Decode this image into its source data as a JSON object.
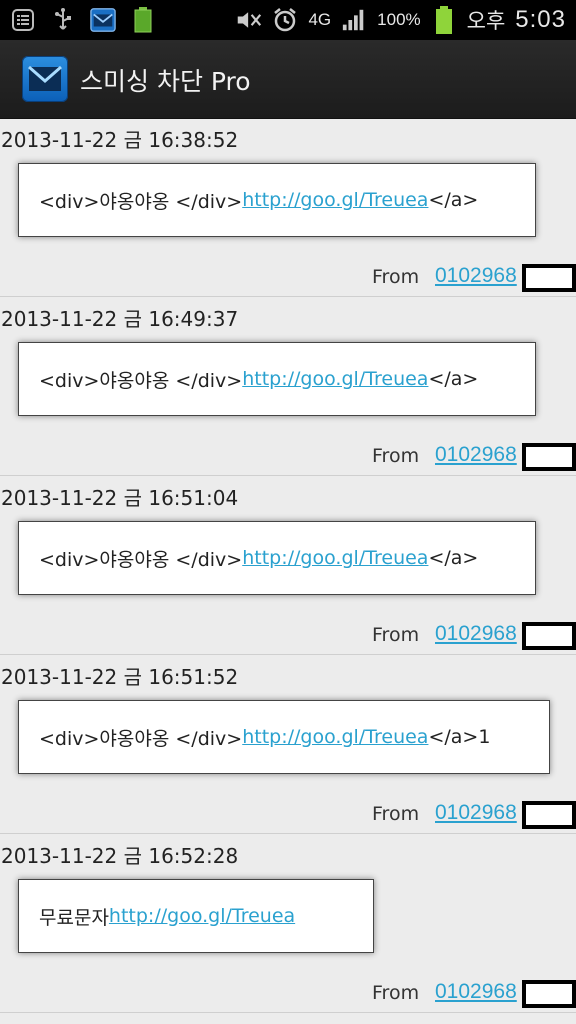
{
  "status_bar": {
    "battery_percent": "100%",
    "network": "4G",
    "ampm": "오후",
    "time": "5:03",
    "icons": [
      "list-icon",
      "usb-icon",
      "mail-icon",
      "battery-small-icon",
      "mute-icon",
      "alarm-icon",
      "4g-icon",
      "signal-icon",
      "battery-icon"
    ]
  },
  "action_bar": {
    "title": "스미싱 차단 Pro"
  },
  "messages": [
    {
      "timestamp": "2013-11-22 금 16:38:52",
      "text_before": "<div>야옹야옹 </div>",
      "link": "http://goo.gl/Treuea",
      "text_after": "</a>",
      "from_label": "From",
      "from_number": "0102968"
    },
    {
      "timestamp": "2013-11-22 금 16:49:37",
      "text_before": "<div>야옹야옹 </div>",
      "link": "http://goo.gl/Treuea",
      "text_after": "</a>",
      "from_label": "From",
      "from_number": "0102968"
    },
    {
      "timestamp": "2013-11-22 금 16:51:04",
      "text_before": "<div>야옹야옹 </div>",
      "link": "http://goo.gl/Treuea",
      "text_after": "</a>",
      "from_label": "From",
      "from_number": "0102968"
    },
    {
      "timestamp": "2013-11-22 금 16:51:52",
      "text_before": "<div>야옹야옹 </div>",
      "link": "http://goo.gl/Treuea",
      "text_after": "</a>1",
      "from_label": "From",
      "from_number": "0102968"
    },
    {
      "timestamp": "2013-11-22 금 16:52:28",
      "text_before": "무료문자 ",
      "link": "http://goo.gl/Treuea",
      "text_after": "",
      "from_label": "From",
      "from_number": "0102968"
    }
  ],
  "colors": {
    "link": "#2aa1cf",
    "background": "#ececec",
    "actionbar": "#222222"
  }
}
